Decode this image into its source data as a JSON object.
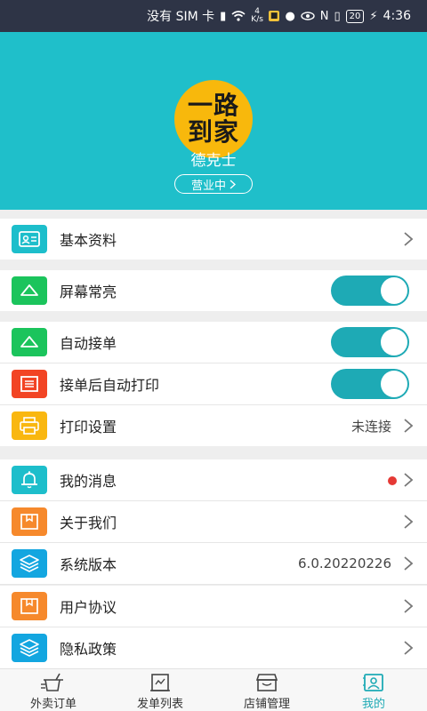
{
  "status_bar": {
    "carrier": "没有 SIM 卡",
    "speed_value": "4",
    "speed_unit": "K/s",
    "battery": "20",
    "time": "4:36"
  },
  "header": {
    "logo_line1": "一路",
    "logo_line2": "到家",
    "shop_name": "德克士",
    "business_status": "营业中",
    "bg_color": "#1fbfca"
  },
  "menu": {
    "basic_info": {
      "label": "基本资料",
      "icon": "id-card-icon"
    },
    "screen_on": {
      "label": "屏幕常亮",
      "icon": "sun-outline-icon",
      "enabled": true
    },
    "auto_accept": {
      "label": "自动接单",
      "icon": "sun-outline-icon",
      "enabled": true
    },
    "auto_print": {
      "label": "接单后自动打印",
      "icon": "receipt-icon",
      "enabled": true
    },
    "print_settings": {
      "label": "打印设置",
      "value": "未连接",
      "icon": "printer-icon"
    },
    "messages": {
      "label": "我的消息",
      "icon": "bell-icon",
      "has_unread": true
    },
    "about": {
      "label": "关于我们",
      "icon": "box-icon"
    },
    "version": {
      "label": "系统版本",
      "value": "6.0.20220226",
      "icon": "layers-icon"
    },
    "user_agreement": {
      "label": "用户协议",
      "icon": "box-icon"
    },
    "privacy": {
      "label": "隐私政策",
      "icon": "layers-icon"
    }
  },
  "bottom_nav": {
    "items": [
      {
        "label": "外卖订单",
        "icon": "takeout-cup-icon"
      },
      {
        "label": "发单列表",
        "icon": "document-list-icon"
      },
      {
        "label": "店铺管理",
        "icon": "store-icon"
      },
      {
        "label": "我的",
        "icon": "profile-card-icon",
        "active": true
      }
    ]
  },
  "colors": {
    "accent": "#1eaab5",
    "unread_dot": "#e53935"
  }
}
